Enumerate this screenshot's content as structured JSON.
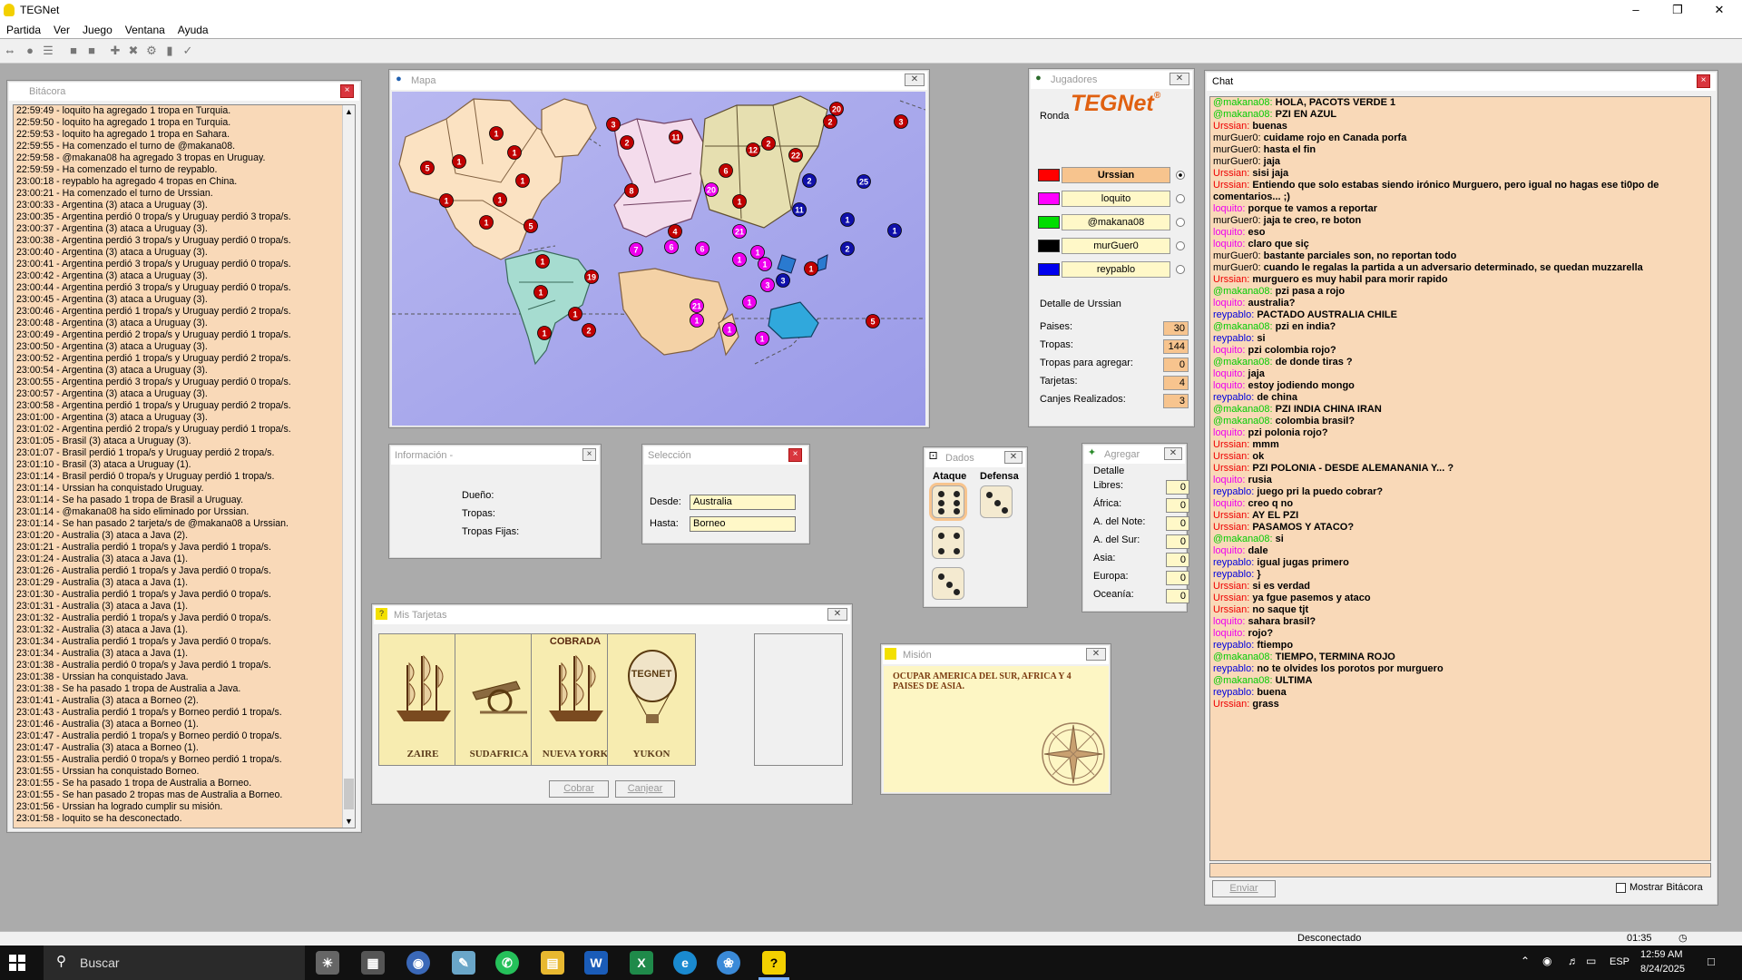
{
  "app": {
    "title": "TEGNet"
  },
  "menu": [
    "Partida",
    "Ver",
    "Juego",
    "Ventana",
    "Ayuda"
  ],
  "windows": {
    "log": "Bitácora",
    "map": "Mapa",
    "info": "Información -",
    "selection": "Selección",
    "cards": "Mis Tarjetas",
    "dice": "Dados",
    "add": "Agregar",
    "mission": "Misión",
    "players": "Jugadores",
    "chat": "Chat"
  },
  "log_lines": [
    "22:59:49 - loquito ha agregado 1 tropa en Turquia.",
    "22:59:50 - loquito ha agregado 1 tropa en Turquia.",
    "22:59:53 - loquito ha agregado 1 tropa en Sahara.",
    "22:59:55 - Ha comenzado el turno de @makana08.",
    "22:59:58 - @makana08 ha agregado 3 tropas en Uruguay.",
    "22:59:59 - Ha comenzado el turno de reypablo.",
    "23:00:18 - reypablo ha agregado 4 tropas en China.",
    "23:00:21 - Ha comenzado el turno de Urssian.",
    "23:00:33 - Argentina (3) ataca a Uruguay (3).",
    "23:00:35 - Argentina perdió 0 tropa/s y Uruguay perdió 3 tropa/s.",
    "23:00:37 - Argentina (3) ataca a Uruguay (3).",
    "23:00:38 - Argentina perdió 3 tropa/s y Uruguay perdió 0 tropa/s.",
    "23:00:40 - Argentina (3) ataca a Uruguay (3).",
    "23:00:41 - Argentina perdió 3 tropa/s y Uruguay perdió 0 tropa/s.",
    "23:00:42 - Argentina (3) ataca a Uruguay (3).",
    "23:00:44 - Argentina perdió 3 tropa/s y Uruguay perdió 0 tropa/s.",
    "23:00:45 - Argentina (3) ataca a Uruguay (3).",
    "23:00:46 - Argentina perdió 1 tropa/s y Uruguay perdió 2 tropa/s.",
    "23:00:48 - Argentina (3) ataca a Uruguay (3).",
    "23:00:49 - Argentina perdió 2 tropa/s y Uruguay perdió 1 tropa/s.",
    "23:00:50 - Argentina (3) ataca a Uruguay (3).",
    "23:00:52 - Argentina perdió 1 tropa/s y Uruguay perdió 2 tropa/s.",
    "23:00:54 - Argentina (3) ataca a Uruguay (3).",
    "23:00:55 - Argentina perdió 3 tropa/s y Uruguay perdió 0 tropa/s.",
    "23:00:57 - Argentina (3) ataca a Uruguay (3).",
    "23:00:58 - Argentina perdió 1 tropa/s y Uruguay perdió 2 tropa/s.",
    "23:01:00 - Argentina (3) ataca a Uruguay (3).",
    "23:01:02 - Argentina perdió 2 tropa/s y Uruguay perdió 1 tropa/s.",
    "23:01:05 - Brasil (3) ataca a Uruguay (3).",
    "23:01:07 - Brasil perdió 1 tropa/s y Uruguay perdió 2 tropa/s.",
    "23:01:10 - Brasil (3) ataca a Uruguay (1).",
    "23:01:14 - Brasil perdió 0 tropa/s y Uruguay perdió 1 tropa/s.",
    "23:01:14 - Urssian ha conquistado Uruguay.",
    "23:01:14 - Se ha pasado 1 tropa de Brasil a Uruguay.",
    "23:01:14 - @makana08 ha sido eliminado por Urssian.",
    "23:01:14 - Se han pasado 2 tarjeta/s de @makana08 a Urssian.",
    "23:01:20 - Australia (3) ataca a Java (2).",
    "23:01:21 - Australia perdió 1 tropa/s y Java perdió 1 tropa/s.",
    "23:01:24 - Australia (3) ataca a Java (1).",
    "23:01:26 - Australia perdió 1 tropa/s y Java perdió 0 tropa/s.",
    "23:01:29 - Australia (3) ataca a Java (1).",
    "23:01:30 - Australia perdió 1 tropa/s y Java perdió 0 tropa/s.",
    "23:01:31 - Australia (3) ataca a Java (1).",
    "23:01:32 - Australia perdió 1 tropa/s y Java perdió 0 tropa/s.",
    "23:01:32 - Australia (3) ataca a Java (1).",
    "23:01:34 - Australia perdió 1 tropa/s y Java perdió 0 tropa/s.",
    "23:01:34 - Australia (3) ataca a Java (1).",
    "23:01:38 - Australia perdió 0 tropa/s y Java perdió 1 tropa/s.",
    "23:01:38 - Urssian ha conquistado Java.",
    "23:01:38 - Se ha pasado 1 tropa de Australia a Java.",
    "23:01:41 - Australia (3) ataca a Borneo (2).",
    "23:01:43 - Australia perdió 1 tropa/s y Borneo perdió 1 tropa/s.",
    "23:01:46 - Australia (3) ataca a Borneo (1).",
    "23:01:47 - Australia perdió 1 tropa/s y Borneo perdió 0 tropa/s.",
    "23:01:47 - Australia (3) ataca a Borneo (1).",
    "23:01:55 - Australia perdió 0 tropa/s y Borneo perdió 1 tropa/s.",
    "23:01:55 - Urssian ha conquistado Borneo.",
    "23:01:55 - Se ha pasado 1 tropa de Australia a Borneo.",
    "23:01:55 - Se han pasado 2 tropas mas de Australia a Borneo.",
    "23:01:56 - Urssian ha logrado cumplir su misión.",
    "23:01:58 - loquito se ha desconectado."
  ],
  "info": {
    "owner_label": "Dueño:",
    "troops_label": "Tropas:",
    "fixed_label": "Tropas Fijas:"
  },
  "selection": {
    "from_label": "Desde:",
    "from": "Australia",
    "to_label": "Hasta:",
    "to": "Borneo"
  },
  "cards": {
    "items": [
      {
        "name": "ZAIRE",
        "symbol": "ship-icon",
        "stamp": ""
      },
      {
        "name": "SUDAFRICA",
        "symbol": "cannon-icon",
        "stamp": ""
      },
      {
        "name": "NUEVA YORK",
        "symbol": "ship-icon",
        "stamp": "COBRADA"
      },
      {
        "name": "YUKON",
        "symbol": "balloon-icon",
        "stamp": ""
      }
    ],
    "balloon_text": "TEGNET",
    "collect": "Cobrar",
    "exchange": "Canjear"
  },
  "dice": {
    "attack_label": "Ataque",
    "defense_label": "Defensa",
    "attack": [
      6,
      4,
      3
    ],
    "defense": [
      3
    ]
  },
  "add": {
    "detail_label": "Detalle",
    "rows": [
      {
        "label": "Libres:",
        "value": "0"
      },
      {
        "label": "África:",
        "value": "0"
      },
      {
        "label": "A. del Note:",
        "value": "0"
      },
      {
        "label": "A. del Sur:",
        "value": "0"
      },
      {
        "label": "Asia:",
        "value": "0"
      },
      {
        "label": "Europa:",
        "value": "0"
      },
      {
        "label": "Oceanía:",
        "value": "0"
      }
    ]
  },
  "mission": {
    "text": "OCUPAR AMERICA DEL SUR, AFRICA Y 4 PAISES DE ASIA."
  },
  "players": {
    "logo": "TEGNet",
    "logo_mark": "®",
    "round_label": "Ronda",
    "list": [
      {
        "name": "Urssian",
        "color": "#ff0000",
        "active": true
      },
      {
        "name": "loquito",
        "color": "#ff00ff",
        "active": false
      },
      {
        "name": "@makana08",
        "color": "#00dd00",
        "active": false
      },
      {
        "name": "murGuer0",
        "color": "#000000",
        "active": false
      },
      {
        "name": "reypablo",
        "color": "#0000ee",
        "active": false
      }
    ],
    "detail_title": "Detalle de Urssian",
    "stats": [
      {
        "label": "Paises:",
        "value": "30"
      },
      {
        "label": "Tropas:",
        "value": "144"
      },
      {
        "label": "Tropas para agregar:",
        "value": "0"
      },
      {
        "label": "Tarjetas:",
        "value": "4"
      },
      {
        "label": "Canjes Realizados:",
        "value": "3"
      }
    ]
  },
  "chat": {
    "lines": [
      {
        "nick": "@makana08:",
        "color": "#00cc00",
        "text": "HOLA, PACOTS VERDE 1"
      },
      {
        "nick": "@makana08:",
        "color": "#00cc00",
        "text": "PZI EN AZUL"
      },
      {
        "nick": "Urssian:",
        "color": "#ee0000",
        "text": "buenas"
      },
      {
        "nick": "murGuer0:",
        "color": "#000000",
        "text": "cuidame rojo en Canada porfa"
      },
      {
        "nick": "murGuer0:",
        "color": "#000000",
        "text": "hasta el fin"
      },
      {
        "nick": "murGuer0:",
        "color": "#000000",
        "text": "jaja"
      },
      {
        "nick": "Urssian:",
        "color": "#ee0000",
        "text": "sisi jaja"
      },
      {
        "nick": "Urssian:",
        "color": "#ee0000",
        "text": "Entiendo que solo estabas siendo irónico Murguero, pero igual no hagas ese ti0po de"
      },
      {
        "nick": "",
        "color": "#000000",
        "text": "comentarios... ;)"
      },
      {
        "nick": "loquito:",
        "color": "#ee00ee",
        "text": "porque te vamos a reportar"
      },
      {
        "nick": "murGuer0:",
        "color": "#000000",
        "text": "jaja te creo, re boton"
      },
      {
        "nick": "loquito:",
        "color": "#ee00ee",
        "text": "eso"
      },
      {
        "nick": "loquito:",
        "color": "#ee00ee",
        "text": "claro que siç"
      },
      {
        "nick": "murGuer0:",
        "color": "#000000",
        "text": "bastante parciales son, no reportan todo"
      },
      {
        "nick": "murGuer0:",
        "color": "#000000",
        "text": "cuando le regalas la partida a un adversario determinado, se quedan muzzarella"
      },
      {
        "nick": "Urssian:",
        "color": "#ee0000",
        "text": "murguero es muy habil para morir rapido"
      },
      {
        "nick": "@makana08:",
        "color": "#00cc00",
        "text": "pzi pasa a rojo"
      },
      {
        "nick": "loquito:",
        "color": "#ee00ee",
        "text": "australia?"
      },
      {
        "nick": "reypablo:",
        "color": "#0000dd",
        "text": "PACTADO AUSTRALIA CHILE"
      },
      {
        "nick": "@makana08:",
        "color": "#00cc00",
        "text": "pzi en india?"
      },
      {
        "nick": "reypablo:",
        "color": "#0000dd",
        "text": "si"
      },
      {
        "nick": "loquito:",
        "color": "#ee00ee",
        "text": "pzi colombia rojo?"
      },
      {
        "nick": "@makana08:",
        "color": "#00cc00",
        "text": "de donde tiras ?"
      },
      {
        "nick": "loquito:",
        "color": "#ee00ee",
        "text": "jaja"
      },
      {
        "nick": "loquito:",
        "color": "#ee00ee",
        "text": "estoy jodiendo mongo"
      },
      {
        "nick": "reypablo:",
        "color": "#0000dd",
        "text": "de china"
      },
      {
        "nick": "@makana08:",
        "color": "#00cc00",
        "text": "PZI INDIA CHINA IRAN"
      },
      {
        "nick": "@makana08:",
        "color": "#00cc00",
        "text": "colombia brasil?"
      },
      {
        "nick": "loquito:",
        "color": "#ee00ee",
        "text": "pzi polonia rojo?"
      },
      {
        "nick": "Urssian:",
        "color": "#ee0000",
        "text": "mmm"
      },
      {
        "nick": "Urssian:",
        "color": "#ee0000",
        "text": "ok"
      },
      {
        "nick": "Urssian:",
        "color": "#ee0000",
        "text": "PZI POLONIA - DESDE ALEMANANIA Y... ?"
      },
      {
        "nick": "loquito:",
        "color": "#ee00ee",
        "text": "rusia"
      },
      {
        "nick": "reypablo:",
        "color": "#0000dd",
        "text": "juego pri la puedo cobrar?"
      },
      {
        "nick": "loquito:",
        "color": "#ee00ee",
        "text": "creo q no"
      },
      {
        "nick": "Urssian:",
        "color": "#ee0000",
        "text": "AY EL PZI"
      },
      {
        "nick": "Urssian:",
        "color": "#ee0000",
        "text": "PASAMOS Y ATACO?"
      },
      {
        "nick": "@makana08:",
        "color": "#00cc00",
        "text": "si"
      },
      {
        "nick": "loquito:",
        "color": "#ee00ee",
        "text": "dale"
      },
      {
        "nick": "reypablo:",
        "color": "#0000dd",
        "text": "igual jugas primero"
      },
      {
        "nick": "reypablo:",
        "color": "#0000dd",
        "text": "}"
      },
      {
        "nick": "Urssian:",
        "color": "#ee0000",
        "text": "si es verdad"
      },
      {
        "nick": "Urssian:",
        "color": "#ee0000",
        "text": "ya fgue pasemos y ataco"
      },
      {
        "nick": "Urssian:",
        "color": "#ee0000",
        "text": "no saque tjt"
      },
      {
        "nick": "loquito:",
        "color": "#ee00ee",
        "text": "sahara brasil?"
      },
      {
        "nick": "loquito:",
        "color": "#ee00ee",
        "text": "rojo?"
      },
      {
        "nick": "reypablo:",
        "color": "#0000dd",
        "text": "ftiempo"
      },
      {
        "nick": "@makana08:",
        "color": "#00cc00",
        "text": "TIEMPO, TERMINA ROJO"
      },
      {
        "nick": "reypablo:",
        "color": "#0000dd",
        "text": "no te olvides los porotos por murguero"
      },
      {
        "nick": "@makana08:",
        "color": "#00cc00",
        "text": "ULTIMA"
      },
      {
        "nick": "reypablo:",
        "color": "#0000dd",
        "text": "buena"
      },
      {
        "nick": "Urssian:",
        "color": "#ee0000",
        "text": "grass"
      }
    ],
    "send": "Enviar",
    "show_log": "Mostrar Bitácora"
  },
  "status": {
    "connection": "Desconectado",
    "timer": "01:35"
  },
  "taskbar": {
    "search_placeholder": "Buscar",
    "time": "12:59 AM",
    "date": "8/24/2025",
    "lang": "ESP"
  },
  "map_armies": [
    {
      "n": "1",
      "c": "#c00000"
    },
    {
      "n": "1",
      "c": "#c00000"
    },
    {
      "n": "5",
      "c": "#c00000"
    },
    {
      "n": "1",
      "c": "#c00000"
    },
    {
      "n": "1",
      "c": "#c00000"
    },
    {
      "n": "1",
      "c": "#c00000"
    },
    {
      "n": "1",
      "c": "#c00000"
    },
    {
      "n": "1",
      "c": "#c00000"
    },
    {
      "n": "5",
      "c": "#c00000"
    },
    {
      "n": "3",
      "c": "#c00000"
    },
    {
      "n": "1",
      "c": "#c00000"
    },
    {
      "n": "19",
      "c": "#c00000"
    },
    {
      "n": "1",
      "c": "#c00000"
    },
    {
      "n": "1",
      "c": "#c00000"
    },
    {
      "n": "1",
      "c": "#c00000"
    },
    {
      "n": "2",
      "c": "#c00000"
    },
    {
      "n": "2",
      "c": "#c00000"
    },
    {
      "n": "11",
      "c": "#c00000"
    },
    {
      "n": "8",
      "c": "#c00000"
    },
    {
      "n": "6",
      "c": "#c00000"
    },
    {
      "n": "4",
      "c": "#c00000"
    },
    {
      "n": "1",
      "c": "#c00000"
    },
    {
      "n": "2",
      "c": "#c00000"
    },
    {
      "n": "20",
      "c": "#c00000"
    },
    {
      "n": "12",
      "c": "#c00000"
    },
    {
      "n": "22",
      "c": "#c00000"
    },
    {
      "n": "2",
      "c": "#c00000"
    },
    {
      "n": "3",
      "c": "#c00000"
    },
    {
      "n": "1",
      "c": "#c00000"
    },
    {
      "n": "5",
      "c": "#c00000"
    },
    {
      "n": "20",
      "c": "#ee00ee"
    },
    {
      "n": "6",
      "c": "#ee00ee"
    },
    {
      "n": "6",
      "c": "#ee00ee"
    },
    {
      "n": "7",
      "c": "#ee00ee"
    },
    {
      "n": "21",
      "c": "#ee00ee"
    },
    {
      "n": "1",
      "c": "#ee00ee"
    },
    {
      "n": "1",
      "c": "#ee00ee"
    },
    {
      "n": "3",
      "c": "#ee00ee"
    },
    {
      "n": "21",
      "c": "#ee00ee"
    },
    {
      "n": "1",
      "c": "#ee00ee"
    },
    {
      "n": "1",
      "c": "#ee00ee"
    },
    {
      "n": "1",
      "c": "#ee00ee"
    },
    {
      "n": "1",
      "c": "#ee00ee"
    },
    {
      "n": "1",
      "c": "#ee00ee"
    },
    {
      "n": "2",
      "c": "#1010aa"
    },
    {
      "n": "25",
      "c": "#1010aa"
    },
    {
      "n": "1",
      "c": "#1010aa"
    },
    {
      "n": "11",
      "c": "#1010aa"
    },
    {
      "n": "1",
      "c": "#1010aa"
    },
    {
      "n": "2",
      "c": "#1010aa"
    },
    {
      "n": "3",
      "c": "#1010aa"
    }
  ]
}
